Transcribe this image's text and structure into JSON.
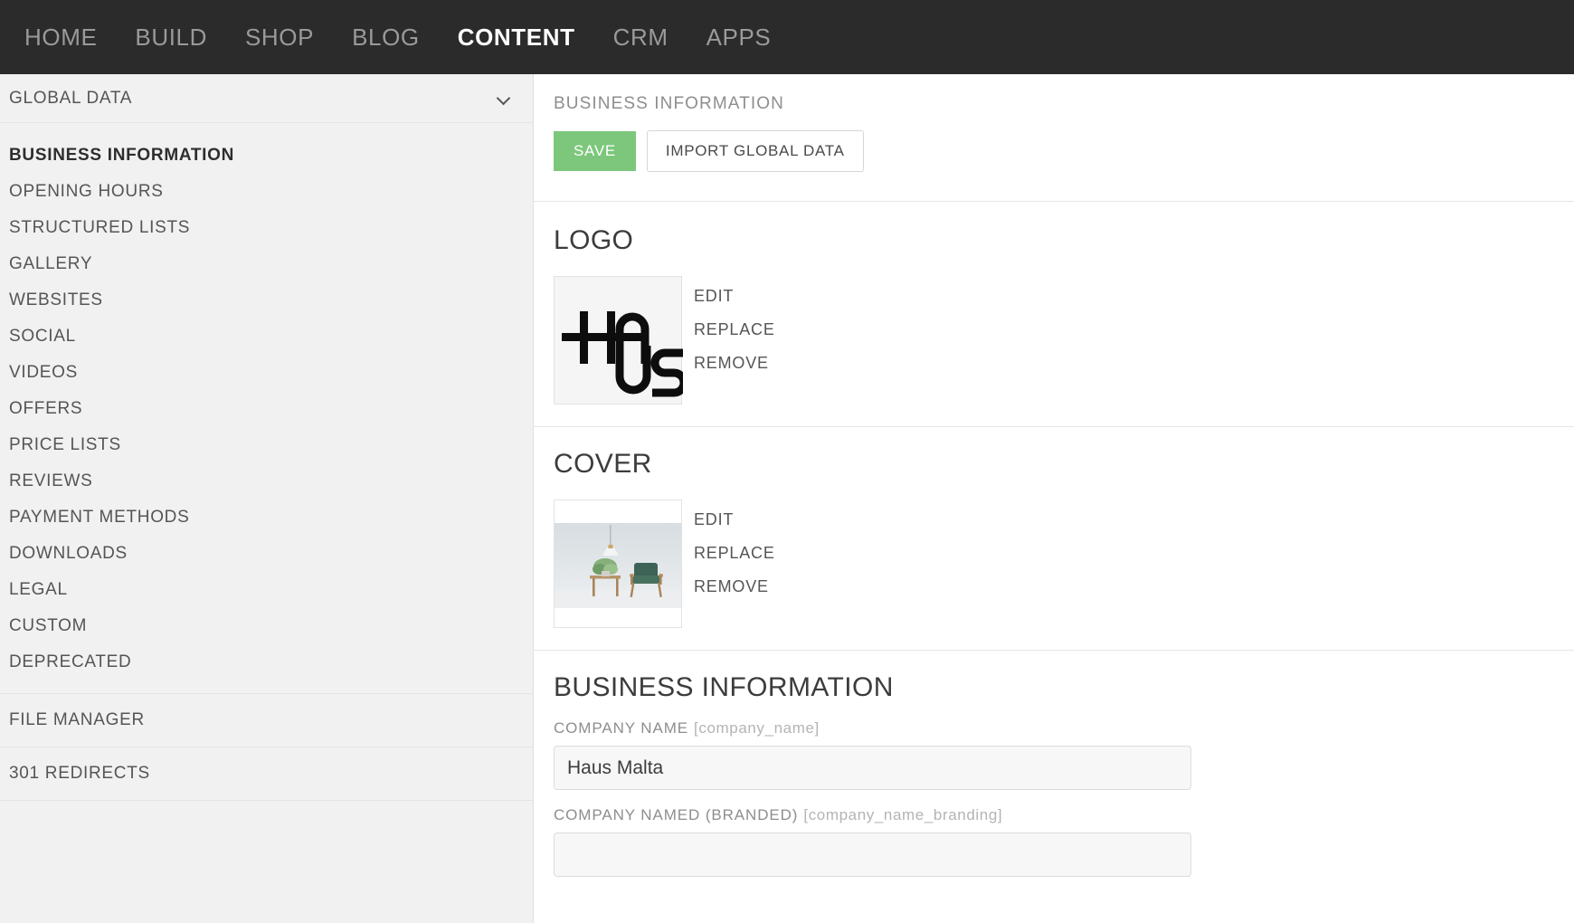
{
  "topnav": {
    "items": [
      {
        "label": "HOME",
        "active": false
      },
      {
        "label": "BUILD",
        "active": false
      },
      {
        "label": "SHOP",
        "active": false
      },
      {
        "label": "BLOG",
        "active": false
      },
      {
        "label": "CONTENT",
        "active": true
      },
      {
        "label": "CRM",
        "active": false
      },
      {
        "label": "APPS",
        "active": false
      }
    ]
  },
  "sidebar": {
    "header": {
      "label": "GLOBAL DATA",
      "icon": "chevron-down-icon"
    },
    "items": [
      {
        "label": "BUSINESS INFORMATION",
        "active": true
      },
      {
        "label": "OPENING HOURS",
        "active": false
      },
      {
        "label": "STRUCTURED LISTS",
        "active": false
      },
      {
        "label": "GALLERY",
        "active": false
      },
      {
        "label": "WEBSITES",
        "active": false
      },
      {
        "label": "SOCIAL",
        "active": false
      },
      {
        "label": "VIDEOS",
        "active": false
      },
      {
        "label": "OFFERS",
        "active": false
      },
      {
        "label": "PRICE LISTS",
        "active": false
      },
      {
        "label": "REVIEWS",
        "active": false
      },
      {
        "label": "PAYMENT METHODS",
        "active": false
      },
      {
        "label": "DOWNLOADS",
        "active": false
      },
      {
        "label": "LEGAL",
        "active": false
      },
      {
        "label": "CUSTOM",
        "active": false
      },
      {
        "label": "DEPRECATED",
        "active": false
      }
    ],
    "blocks": [
      {
        "label": "FILE MANAGER"
      },
      {
        "label": "301 REDIRECTS"
      }
    ]
  },
  "main": {
    "eyebrow": "BUSINESS INFORMATION",
    "actions": {
      "save_label": "SAVE",
      "import_label": "IMPORT GLOBAL DATA"
    },
    "logo_section": {
      "title": "LOGO",
      "thumb_alt": "HAUS",
      "actions": [
        {
          "label": "EDIT"
        },
        {
          "label": "REPLACE"
        },
        {
          "label": "REMOVE"
        }
      ]
    },
    "cover_section": {
      "title": "COVER",
      "thumb_alt": "interior with green armchair",
      "actions": [
        {
          "label": "EDIT"
        },
        {
          "label": "REPLACE"
        },
        {
          "label": "REMOVE"
        }
      ]
    },
    "form_section": {
      "title": "BUSINESS INFORMATION",
      "fields": [
        {
          "label": "COMPANY NAME",
          "token": "[company_name]",
          "value": "Haus Malta",
          "placeholder": ""
        },
        {
          "label": "COMPANY NAMED (BRANDED)",
          "token": "[company_name_branding]",
          "value": "",
          "placeholder": ""
        }
      ]
    }
  },
  "colors": {
    "nav_bg": "#2b2b2b",
    "sidebar_bg": "#f1f1f1",
    "accent_green": "#7cc77c",
    "text_muted": "#8e8e8e",
    "border": "#e2e2e2"
  }
}
